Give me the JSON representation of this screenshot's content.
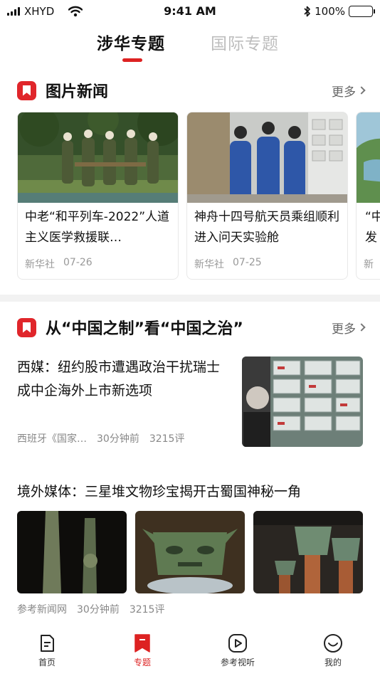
{
  "status_bar": {
    "carrier": "XHYD",
    "time": "9:41 AM",
    "battery": "100%"
  },
  "top_tabs": [
    {
      "label": "涉华专题",
      "active": true
    },
    {
      "label": "国际专题",
      "active": false
    }
  ],
  "photo_news": {
    "title": "图片新闻",
    "more": "更多",
    "cards": [
      {
        "title": "中老“和平列车-2022”人道主义医学救援联…",
        "source": "新华社",
        "date": "07-26"
      },
      {
        "title": "神舟十四号航天员乘组顺利进入问天实验舱",
        "source": "新华社",
        "date": "07-25"
      },
      {
        "title": "“中发",
        "source": "新",
        "date": ""
      }
    ]
  },
  "topic_section": {
    "title": "从“中国之制”看“中国之治”",
    "more": "更多",
    "articles": [
      {
        "title": "西媒：纽约股市遭遇政治干扰瑞士成中企海外上市新选项",
        "source": "西班牙《国家…",
        "time": "30分钟前",
        "comments": "3215评"
      },
      {
        "title": "境外媒体：三星堆文物珍宝揭开古蜀国神秘一角",
        "source": "参考新闻网",
        "time": "30分钟前",
        "comments": "3215评"
      }
    ]
  },
  "bottom_nav": [
    {
      "label": "首页",
      "icon": "document-icon",
      "active": false
    },
    {
      "label": "专题",
      "icon": "bookmark-icon",
      "active": true
    },
    {
      "label": "参考视听",
      "icon": "play-icon",
      "active": false
    },
    {
      "label": "我的",
      "icon": "smile-icon",
      "active": false
    }
  ],
  "colors": {
    "accent": "#e0262b",
    "inactive_tab": "#bdbdbd",
    "meta_text": "#999999"
  }
}
